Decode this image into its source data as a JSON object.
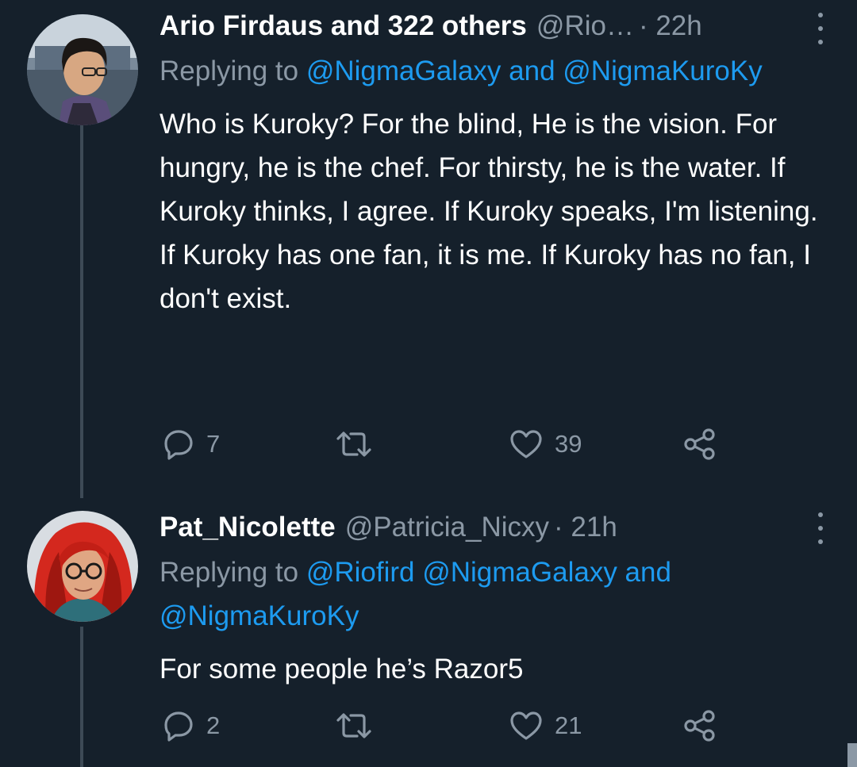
{
  "tweets": [
    {
      "name": "Ario Firdaus and 322 others",
      "handle": "@Rio…",
      "time": "· 22h",
      "replying_prefix": "Replying to ",
      "replying_mentions": "@NigmaGalaxy and @NigmaKuroKy",
      "text": "Who is Kuroky? For the blind, He is the vision. For hungry, he is the chef. For thirsty, he is the water. If Kuroky thinks, I agree. If Kuroky speaks, I'm listening. If Kuroky has one fan, it is me. If Kuroky has no fan, I don't exist.",
      "replies": "7",
      "retweets": "",
      "likes": "39",
      "avatar_icon": "avatar-photo-man-glasses"
    },
    {
      "name": "Pat_Nicolette",
      "handle": "@Patricia_Nicxy",
      "time": "· 21h",
      "replying_prefix": "Replying to ",
      "replying_mentions": "@Riofird @NigmaGalaxy and @NigmaKuroKy",
      "text": "For some people he’s Razor5",
      "replies": "2",
      "retweets": "",
      "likes": "21",
      "avatar_icon": "avatar-illustration-red-hair-glasses"
    }
  ],
  "icons": {
    "reply": "reply-icon",
    "retweet": "retweet-icon",
    "like": "like-icon",
    "share": "share-icon",
    "more": "more-icon"
  },
  "colors": {
    "background": "#15202b",
    "primary_text": "#ffffff",
    "secondary_text": "#8b98a5",
    "link": "#1d9bf0",
    "thread_line": "#3d4a56"
  }
}
